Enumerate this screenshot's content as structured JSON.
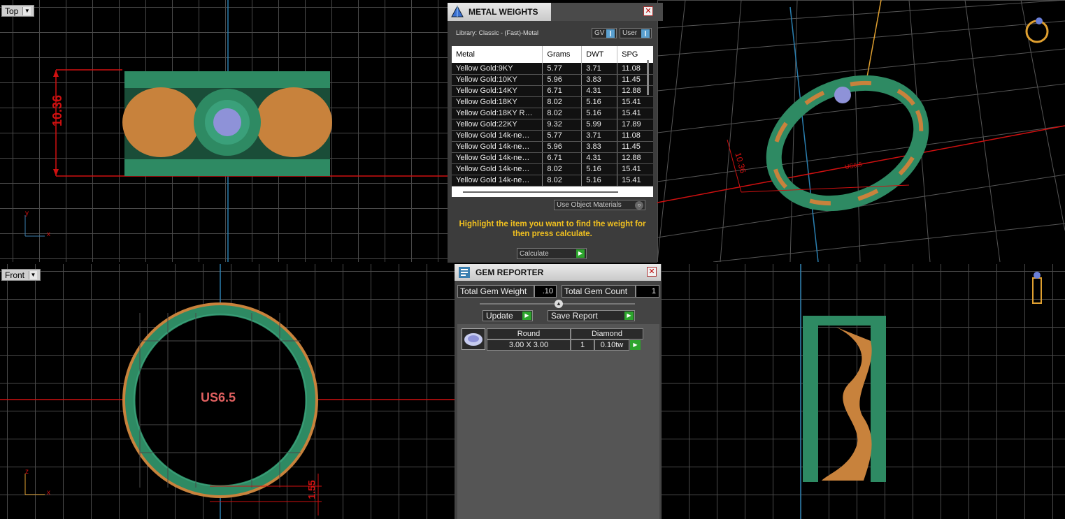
{
  "viewports": {
    "top": {
      "label": "Top",
      "dimension": "10.36",
      "axis_x": "x",
      "axis_y": "y"
    },
    "front": {
      "label": "Front",
      "size_label": "US6.5",
      "dimension": "1.55",
      "axis_x": "x",
      "axis_z": "z"
    },
    "perspective": {
      "dimension": "10.36",
      "size_label": "US6.5"
    }
  },
  "metal_weights": {
    "title": "METAL WEIGHTS",
    "library": "Library: Classic - (Fast)-Metal",
    "gv_label": "GV",
    "user_label": "User",
    "columns": [
      "Metal",
      "Grams",
      "DWT",
      "SPG"
    ],
    "rows": [
      [
        "Yellow Gold:9KY",
        "5.77",
        "3.71",
        "11.08"
      ],
      [
        "Yellow Gold:10KY",
        "5.96",
        "3.83",
        "11.45"
      ],
      [
        "Yellow Gold:14KY",
        "6.71",
        "4.31",
        "12.88"
      ],
      [
        "Yellow Gold:18KY",
        "8.02",
        "5.16",
        "15.41"
      ],
      [
        "Yellow Gold:18KY R…",
        "8.02",
        "5.16",
        "15.41"
      ],
      [
        "Yellow Gold:22KY",
        "9.32",
        "5.99",
        "17.89"
      ],
      [
        "Yellow Gold 14k-ne…",
        "5.77",
        "3.71",
        "11.08"
      ],
      [
        "Yellow Gold 14k-ne…",
        "5.96",
        "3.83",
        "11.45"
      ],
      [
        "Yellow Gold 14k-ne…",
        "6.71",
        "4.31",
        "12.88"
      ],
      [
        "Yellow Gold 14k-ne…",
        "8.02",
        "5.16",
        "15.41"
      ],
      [
        "Yellow Gold 14k-ne…",
        "8.02",
        "5.16",
        "15.41"
      ]
    ],
    "use_object_materials": "Use Object Materials",
    "instruction": "Highlight the item you want to find the weight for then press calculate.",
    "calculate_label": "Calculate"
  },
  "gem_reporter": {
    "title": "GEM REPORTER",
    "total_weight_label": "Total Gem Weight",
    "total_weight_value": ".10",
    "total_count_label": "Total Gem Count",
    "total_count_value": "1",
    "update_label": "Update",
    "save_report_label": "Save Report",
    "gem": {
      "shape": "Round",
      "material": "Diamond",
      "size": "3.00 X 3.00",
      "count": "1",
      "weight": "0.10tw"
    }
  },
  "colors": {
    "ring_green": "#2e8a63",
    "ring_gold": "#c8823c",
    "axis_red": "#d01010",
    "axis_blue": "#2a7fb0",
    "instruction_yellow": "#f0c020",
    "button_green": "#2da52d"
  },
  "icons": [
    "pyramid-icon",
    "close-icon",
    "gem-report-icon",
    "diamond-icon",
    "ring-icon",
    "pendant-icon"
  ]
}
